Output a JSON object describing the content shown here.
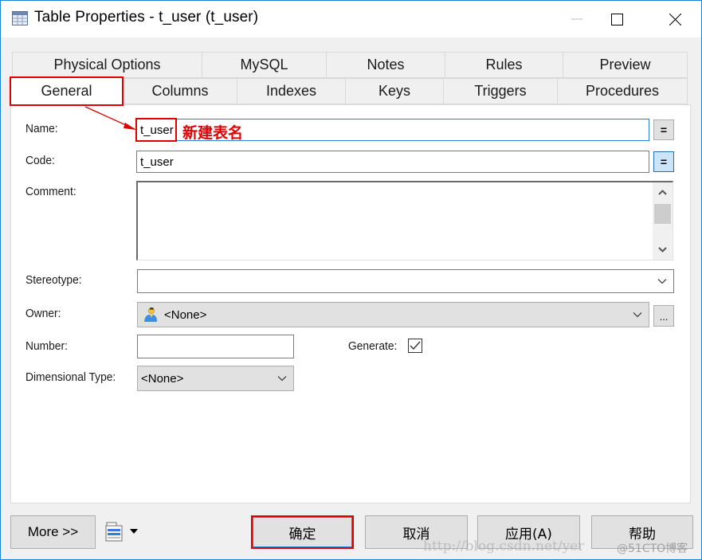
{
  "window": {
    "title": "Table Properties - t_user (t_user)",
    "icon": "table-grid-icon",
    "controls": [
      "minimize-icon",
      "maximize-icon",
      "close-icon"
    ]
  },
  "tabs": {
    "row1": [
      {
        "label": "Physical Options"
      },
      {
        "label": "MySQL"
      },
      {
        "label": "Notes"
      },
      {
        "label": "Rules"
      },
      {
        "label": "Preview"
      }
    ],
    "row2": [
      {
        "label": "General",
        "active": true
      },
      {
        "label": "Columns"
      },
      {
        "label": "Indexes"
      },
      {
        "label": "Keys"
      },
      {
        "label": "Triggers"
      },
      {
        "label": "Procedures"
      }
    ]
  },
  "form": {
    "name": {
      "label": "Name:",
      "value": "t_user",
      "eq_button": "="
    },
    "code": {
      "label": "Code:",
      "value": "t_user",
      "eq_button": "="
    },
    "comment": {
      "label": "Comment:",
      "value": ""
    },
    "stereotype": {
      "label": "Stereotype:",
      "value": ""
    },
    "owner": {
      "label": "Owner:",
      "value": "<None>",
      "browse_button": "...",
      "icon": "user-icon"
    },
    "number": {
      "label": "Number:",
      "value": ""
    },
    "generate": {
      "label": "Generate:",
      "checked": true
    },
    "dimensional_type": {
      "label": "Dimensional Type:",
      "value": "<None>"
    }
  },
  "annotation": {
    "text": "新建表名",
    "color": "#e00000"
  },
  "footer": {
    "more_label": "More >>",
    "menu_icon": "property-sheet-icon",
    "ok_label": "确定",
    "cancel_label": "取消",
    "apply_label": "应用(A)",
    "help_label": "帮助"
  },
  "watermark": {
    "url": "http://blog.csdn.net/yer",
    "brand": "@51CTO博客"
  }
}
